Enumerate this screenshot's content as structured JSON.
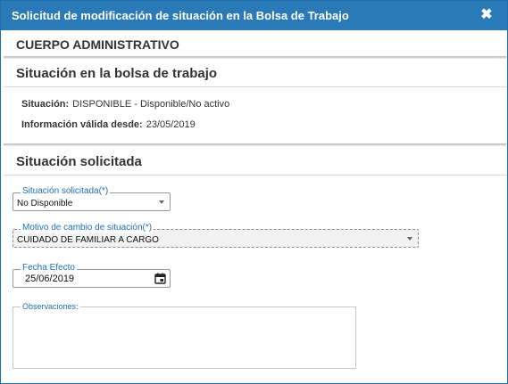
{
  "dialog": {
    "title": "Solicitud de modificación de situación en la Bolsa de Trabajo",
    "close_label": "✖",
    "close_icon": "close-icon"
  },
  "cuerpo": {
    "heading": "CUERPO ADMINISTRATIVO"
  },
  "situacion_actual": {
    "heading": "Situación en la bolsa de trabajo",
    "situacion_label": "Situación:",
    "situacion_value": "DISPONIBLE - Disponible/No activo",
    "valida_label": "Información válida desde:",
    "valida_value": "23/05/2019"
  },
  "situacion_solicitada": {
    "heading": "Situación solicitada",
    "situacion_field": {
      "label": "Situación solicitada(*)",
      "value": "No Disponible"
    },
    "motivo_field": {
      "label": "Motivo de cambio de situación(*)",
      "value": "CUIDADO DE FAMILIAR A CARGO"
    },
    "fecha_field": {
      "label": "Fecha Efecto",
      "value": "25/06/2019",
      "icon": "calendar-icon"
    },
    "observaciones": {
      "label": "Observaciones:",
      "value": ""
    }
  },
  "colors": {
    "titlebar": "#2a7ab8",
    "field_label": "#1f6fb0"
  }
}
